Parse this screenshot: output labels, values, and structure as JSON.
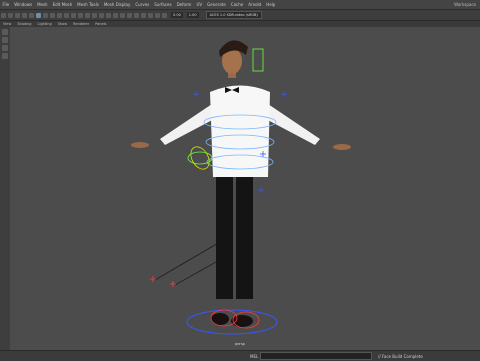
{
  "menubar": {
    "items": [
      "File",
      "Windows",
      "Mesh",
      "Edit Mesh",
      "Mesh Tools",
      "Mesh Display",
      "Curves",
      "Surfaces",
      "Deform",
      "UV",
      "Generate",
      "Cache",
      "Arnold",
      "Help"
    ],
    "workspace": "Workspace"
  },
  "toolbar": {
    "field1": "0.00",
    "field2": "1.00",
    "camera_menu": "ACES 1.0 SDR-video (sRGB)"
  },
  "panel_menu": [
    "View",
    "Shading",
    "Lighting",
    "Show",
    "Renderer",
    "Panels"
  ],
  "viewport": {
    "camera_label": "persp"
  },
  "commandline": {
    "mel_label": "MEL",
    "status_text": "// Face Build Complete"
  },
  "colors": {
    "viewport_bg": "#4c4c4c",
    "control_blue": "#3a55ff",
    "control_red": "#ff3b3b",
    "control_green": "#6cff3a",
    "control_yellow": "#e0e000"
  }
}
